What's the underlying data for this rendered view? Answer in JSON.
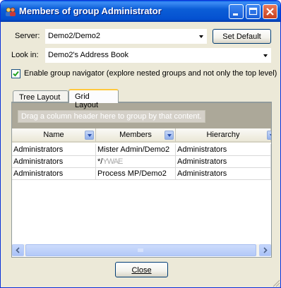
{
  "window": {
    "title": "Members of group Administrator"
  },
  "server": {
    "label": "Server:",
    "value": "Demo2/Demo2",
    "set_default_label": "Set Default"
  },
  "look_in": {
    "label": "Look in:",
    "value": "Demo2's Address Book"
  },
  "navigator": {
    "checked": true,
    "label": "Enable group navigator (explore nested groups and not only the top level)"
  },
  "tabs": [
    {
      "label": "Tree Layout",
      "active": false
    },
    {
      "label": "Grid Layout",
      "active": true
    }
  ],
  "grid": {
    "group_hint": "Drag a column header here to group by that content.",
    "columns": [
      "Name",
      "Members",
      "Hierarchy"
    ],
    "rows": [
      [
        "Administrators",
        "Mister Admin/Demo2",
        "Administrators"
      ],
      [
        "Administrators",
        "*/",
        "Administrators"
      ],
      [
        "Administrators",
        "Process MP/Demo2",
        "Administrators"
      ]
    ],
    "redacted_text": "YWAE"
  },
  "footer": {
    "close_label": "Close"
  },
  "colors": {
    "titlebar": "#0b5ed7",
    "window_bg": "#ece9d8",
    "group_area": "#aca899",
    "check": "#21a121"
  }
}
